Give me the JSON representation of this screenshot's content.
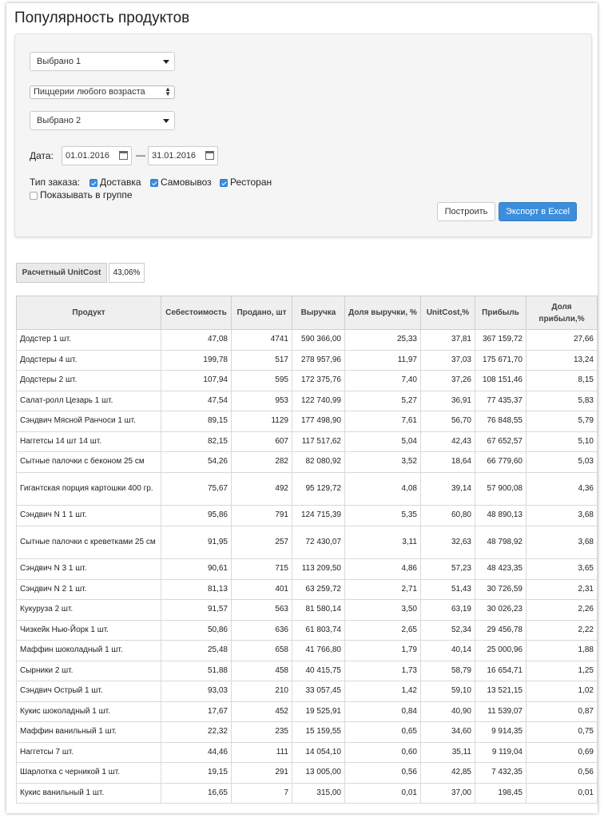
{
  "title": "Популярность продуктов",
  "filters": {
    "select1": "Выбрано 1",
    "select_group": "Пиццерии любого возраста",
    "select2": "Выбрано 2",
    "date_label": "Дата:",
    "date_from": "01.01.2016",
    "date_dash": "—",
    "date_to": "31.01.2016",
    "order_type_label": "Тип заказа:",
    "order_delivery": "Доставка",
    "order_pickup": "Самовывоз",
    "order_restaurant": "Ресторан",
    "show_in_group": "Показывать в группе",
    "build_button": "Построить",
    "export_button": "Экспорт в Excel"
  },
  "unitcost": {
    "label": "Расчетный UnitCost",
    "value": "43,06%"
  },
  "table": {
    "headers": [
      "Продукт",
      "Себестоимость",
      "Продано, шт",
      "Выручка",
      "Доля выручки, %",
      "UnitCost,%",
      "Прибыль",
      "Доля прибыли,%"
    ],
    "rows": [
      [
        "Додстер 1 шт.",
        "47,08",
        "4741",
        "590 366,00",
        "25,33",
        "37,81",
        "367 159,72",
        "27,66"
      ],
      [
        "Додстеры 4 шт.",
        "199,78",
        "517",
        "278 957,96",
        "11,97",
        "37,03",
        "175 671,70",
        "13,24"
      ],
      [
        "Додстеры 2 шт.",
        "107,94",
        "595",
        "172 375,76",
        "7,40",
        "37,26",
        "108 151,46",
        "8,15"
      ],
      [
        "Салат-ролл Цезарь 1 шт.",
        "47,54",
        "953",
        "122 740,99",
        "5,27",
        "36,91",
        "77 435,37",
        "5,83"
      ],
      [
        "Сэндвич Мясной Ранчоси 1 шт.",
        "89,15",
        "1129",
        "177 498,90",
        "7,61",
        "56,70",
        "76 848,55",
        "5,79"
      ],
      [
        "Наггетсы 14 шт 14 шт.",
        "82,15",
        "607",
        "117 517,62",
        "5,04",
        "42,43",
        "67 652,57",
        "5,10"
      ],
      [
        "Сытные палочки с беконом 25 см",
        "54,26",
        "282",
        "82 080,92",
        "3,52",
        "18,64",
        "66 779,60",
        "5,03"
      ],
      [
        "Гигантская порция картошки 400 гр.",
        "75,67",
        "492",
        "95 129,72",
        "4,08",
        "39,14",
        "57 900,08",
        "4,36"
      ],
      [
        "Сэндвич N 1 1 шт.",
        "95,86",
        "791",
        "124 715,39",
        "5,35",
        "60,80",
        "48 890,13",
        "3,68"
      ],
      [
        "Сытные палочки с креветками 25 см",
        "91,95",
        "257",
        "72 430,07",
        "3,11",
        "32,63",
        "48 798,92",
        "3,68"
      ],
      [
        "Сэндвич N 3 1 шт.",
        "90,61",
        "715",
        "113 209,50",
        "4,86",
        "57,23",
        "48 423,35",
        "3,65"
      ],
      [
        "Сэндвич N 2 1 шт.",
        "81,13",
        "401",
        "63 259,72",
        "2,71",
        "51,43",
        "30 726,59",
        "2,31"
      ],
      [
        "Кукуруза 2 шт.",
        "91,57",
        "563",
        "81 580,14",
        "3,50",
        "63,19",
        "30 026,23",
        "2,26"
      ],
      [
        "Чизкейк Нью-Йорк 1 шт.",
        "50,86",
        "636",
        "61 803,74",
        "2,65",
        "52,34",
        "29 456,78",
        "2,22"
      ],
      [
        "Маффин шоколадный 1 шт.",
        "25,48",
        "658",
        "41 766,80",
        "1,79",
        "40,14",
        "25 000,96",
        "1,88"
      ],
      [
        "Сырники 2 шт.",
        "51,88",
        "458",
        "40 415,75",
        "1,73",
        "58,79",
        "16 654,71",
        "1,25"
      ],
      [
        "Сэндвич Острый 1 шт.",
        "93,03",
        "210",
        "33 057,45",
        "1,42",
        "59,10",
        "13 521,15",
        "1,02"
      ],
      [
        "Кукис шоколадный 1 шт.",
        "17,67",
        "452",
        "19 525,91",
        "0,84",
        "40,90",
        "11 539,07",
        "0,87"
      ],
      [
        "Маффин ванильный 1 шт.",
        "22,32",
        "235",
        "15 159,55",
        "0,65",
        "34,60",
        "9 914,35",
        "0,75"
      ],
      [
        "Наггетсы 7 шт.",
        "44,46",
        "111",
        "14 054,10",
        "0,60",
        "35,11",
        "9 119,04",
        "0,69"
      ],
      [
        "Шарлотка с черникой 1 шт.",
        "19,15",
        "291",
        "13 005,00",
        "0,56",
        "42,85",
        "7 432,35",
        "0,56"
      ],
      [
        "Кукис ванильный 1 шт.",
        "16,65",
        "7",
        "315,00",
        "0,01",
        "37,00",
        "198,45",
        "0,01"
      ]
    ]
  }
}
